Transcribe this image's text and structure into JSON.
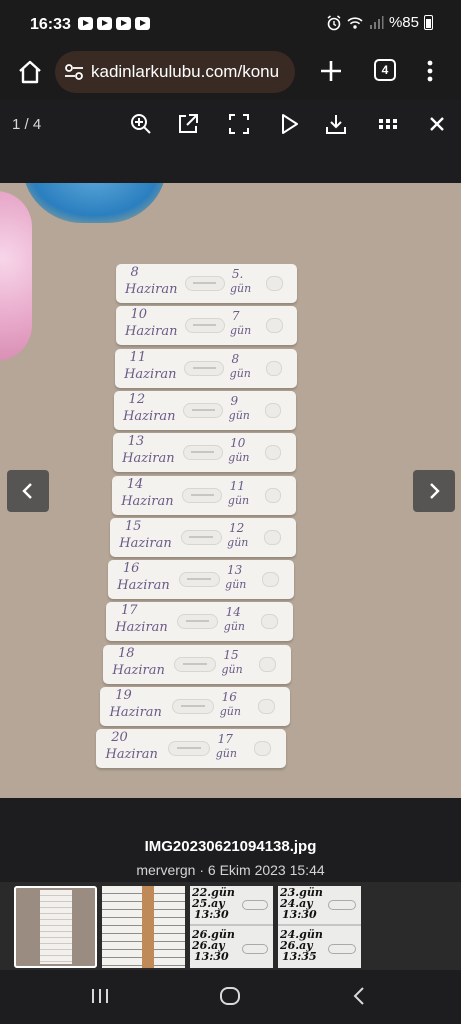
{
  "status_bar": {
    "time": "16:33",
    "battery": "%85"
  },
  "browser": {
    "url": "kadinlarkulubu.com/konu",
    "tab_count": "4"
  },
  "viewer": {
    "counter": "1 / 4"
  },
  "strips": [
    {
      "date": "8",
      "month": "Haziran",
      "day": "5.",
      "gun": "gün"
    },
    {
      "date": "10",
      "month": "Haziran",
      "day": "7",
      "gun": "gün"
    },
    {
      "date": "11",
      "month": "Haziran",
      "day": "8",
      "gun": "gün"
    },
    {
      "date": "12",
      "month": "Haziran",
      "day": "9",
      "gun": "gün"
    },
    {
      "date": "13",
      "month": "Haziran",
      "day": "10",
      "gun": "gün"
    },
    {
      "date": "14",
      "month": "Haziran",
      "day": "11",
      "gun": "gün"
    },
    {
      "date": "15",
      "month": "Haziran",
      "day": "12",
      "gun": "gün"
    },
    {
      "date": "16",
      "month": "Haziran",
      "day": "13",
      "gun": "gün"
    },
    {
      "date": "17",
      "month": "Haziran",
      "day": "14",
      "gun": "gün"
    },
    {
      "date": "18",
      "month": "Haziran",
      "day": "15",
      "gun": "gün"
    },
    {
      "date": "19",
      "month": "Haziran",
      "day": "16",
      "gun": "gün"
    },
    {
      "date": "20",
      "month": "Haziran",
      "day": "17",
      "gun": "gün"
    }
  ],
  "caption": {
    "filename": "IMG20230621094138.jpg",
    "meta": "mervergn · 6 Ekim 2023 15:44"
  },
  "thumbnails": {
    "t3": {
      "a": "22.gün",
      "b": "25.ay",
      "c": "13:30",
      "d": "26.gün",
      "e": "26.ay",
      "f": "13:30"
    },
    "t4": {
      "a": "23.gün",
      "b": "24.ay",
      "c": "13:30",
      "d": "24.gün",
      "e": "26.ay",
      "f": "13:35"
    }
  }
}
